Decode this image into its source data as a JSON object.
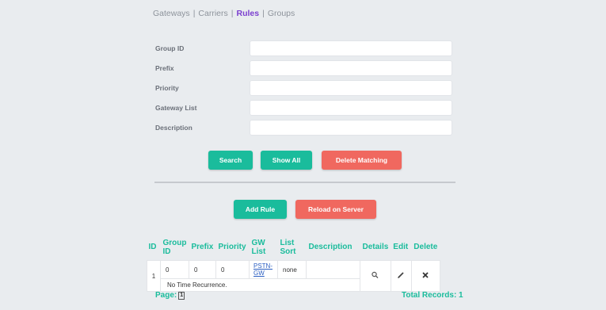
{
  "nav": {
    "items": [
      "Gateways",
      "Carriers",
      "Rules",
      "Groups"
    ],
    "active": "Rules"
  },
  "form": {
    "fields": [
      {
        "label": "Group ID",
        "value": ""
      },
      {
        "label": "Prefix",
        "value": ""
      },
      {
        "label": "Priority",
        "value": ""
      },
      {
        "label": "Gateway List",
        "value": ""
      },
      {
        "label": "Description",
        "value": ""
      }
    ],
    "buttons": {
      "search": "Search",
      "show_all": "Show All",
      "delete_matching": "Delete Matching"
    }
  },
  "actions": {
    "add_rule": "Add Rule",
    "reload": "Reload on Server"
  },
  "colors": {
    "accent_green": "#1abc9c",
    "danger_red": "#f0685f",
    "active_nav": "#7b3fcf"
  },
  "table": {
    "headers": {
      "id": "ID",
      "group_id": "Group ID",
      "prefix": "Prefix",
      "priority": "Priority",
      "gw_list": "GW List",
      "list_sort": "List Sort",
      "description": "Description",
      "details": "Details",
      "edit": "Edit",
      "delete": "Delete"
    },
    "rows": [
      {
        "id": "1",
        "group_id": "0",
        "prefix": "0",
        "priority": "0",
        "gw_list": "PSTN-GW",
        "list_sort": "none",
        "description": "",
        "details_icon": "magnifier-icon",
        "edit_icon": "pencil-icon",
        "delete_icon": "delete-x-icon",
        "note": "No Time Recurrence."
      }
    ]
  },
  "footer": {
    "page_label": "Page:",
    "page_number": "1",
    "total_records": "Total Records: 1"
  }
}
